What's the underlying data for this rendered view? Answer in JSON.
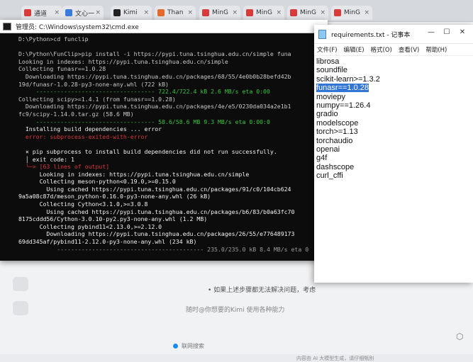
{
  "browser": {
    "tabs": [
      {
        "label": "通道",
        "color": "#d93a3a"
      },
      {
        "label": "文心一",
        "color": "#3a7ad9"
      },
      {
        "label": "Kimi",
        "color": "#222222"
      },
      {
        "label": "Than",
        "color": "#e46b2b"
      },
      {
        "label": "MinG",
        "color": "#d93a3a"
      },
      {
        "label": "MinG",
        "color": "#d93a3a"
      },
      {
        "label": "MinG",
        "color": "#d93a3a"
      },
      {
        "label": "MinG",
        "color": "#d93a3a"
      }
    ],
    "suggestion": "• 如果上述步骤都无法解决问题，考虑",
    "ask_placeholder": "随时@你想要的Kimi 使用各种能力",
    "web_search": "联网搜索",
    "footer_note": "内容由 AI 大模型生成，请仔细甄别"
  },
  "cmd": {
    "title": "管理员: C:\\Windows\\system32\\cmd.exe",
    "lines": [
      {
        "text": "D:\\Python>cd funclip",
        "cls": ""
      },
      {
        "text": "",
        "cls": ""
      },
      {
        "text": "D:\\Python\\FunClip>pip install -i https://pypi.tuna.tsinghua.edu.cn/simple funa",
        "cls": ""
      },
      {
        "text": "Looking in indexes: https://pypi.tuna.tsinghua.edu.cn/simple",
        "cls": ""
      },
      {
        "text": "Collecting funasr==1.0.28",
        "cls": ""
      },
      {
        "text": "  Downloading https://pypi.tuna.tsinghua.edu.cn/packages/68/55/4e0b0b28befd42b",
        "cls": ""
      },
      {
        "text": "19d/funasr-1.0.28-py3-none-any.whl (722 kB)",
        "cls": ""
      },
      {
        "text": "     ---------------------------------- 722.4/722.4 kB 2.6 MB/s eta 0:00",
        "cls": "c-green"
      },
      {
        "text": "Collecting scipy>=1.4.1 (from funasr==1.0.28)",
        "cls": ""
      },
      {
        "text": "  Downloading https://pypi.tuna.tsinghua.edu.cn/packages/4e/e5/0230da034a2e1b1",
        "cls": ""
      },
      {
        "text": "fc9/scipy-1.14.0.tar.gz (58.6 MB)",
        "cls": ""
      },
      {
        "text": "     ---------------------------------- 58.6/58.6 MB 9.3 MB/s eta 0:00:0",
        "cls": "c-green"
      },
      {
        "text": "  Installing build dependencies ... error",
        "cls": "c-white"
      },
      {
        "text": "  error: subprocess-exited-with-error",
        "cls": "c-red"
      },
      {
        "text": "",
        "cls": ""
      },
      {
        "text": "  × pip subprocess to install build dependencies did not run successfully.",
        "cls": "c-white"
      },
      {
        "text": "  │ exit code: 1",
        "cls": "c-white"
      },
      {
        "text": "  ╰─> [63 lines of output]",
        "cls": "c-red"
      },
      {
        "text": "      Looking in indexes: https://pypi.tuna.tsinghua.edu.cn/simple",
        "cls": "c-white"
      },
      {
        "text": "      Collecting meson-python<0.19.0,>=0.15.0",
        "cls": "c-white"
      },
      {
        "text": "        Using cached https://pypi.tuna.tsinghua.edu.cn/packages/91/c0/104cb624",
        "cls": "c-white"
      },
      {
        "text": "9a5a08c87d/meson_python-0.16.0-py3-none-any.whl (26 kB)",
        "cls": "c-white"
      },
      {
        "text": "      Collecting Cython<3.1.0,>=3.0.8",
        "cls": "c-white"
      },
      {
        "text": "        Using cached https://pypi.tuna.tsinghua.edu.cn/packages/b6/83/b0a63fc70",
        "cls": "c-white"
      },
      {
        "text": "8175cddd56/Cython-3.0.10-py2.py3-none-any.whl (1.2 MB)",
        "cls": "c-white"
      },
      {
        "text": "      Collecting pybind11<2.13.0,>=2.12.0",
        "cls": "c-white"
      },
      {
        "text": "        Downloading https://pypi.tuna.tsinghua.edu.cn/packages/26/55/e776489173",
        "cls": "c-white"
      },
      {
        "text": "69dd345af/pybind11-2.12.0-py3-none-any.whl (234 kB)",
        "cls": "c-white"
      },
      {
        "text": "           ------------------------------------------ 235.0/235.0 kB 8.4 MB/s eta 0",
        "cls": "c-dim"
      }
    ]
  },
  "notepad": {
    "title": "requirements.txt - 记事本",
    "menus": [
      "文件(F)",
      "编辑(E)",
      "格式(O)",
      "查看(V)",
      "帮助(H)"
    ],
    "lines": [
      "librosa",
      "soundfile",
      "scikit-learn>=1.3.2",
      "funasr==1.0.28",
      "moviepy",
      "numpy==1.26.4",
      "gradio",
      "modelscope",
      "torch>=1.13",
      "torchaudio",
      "openai",
      "g4f",
      "dashscope",
      "curl_cffi"
    ],
    "selected_index": 3,
    "window_buttons": {
      "minimize": "—",
      "maximize": "☐",
      "close": "✕"
    }
  }
}
